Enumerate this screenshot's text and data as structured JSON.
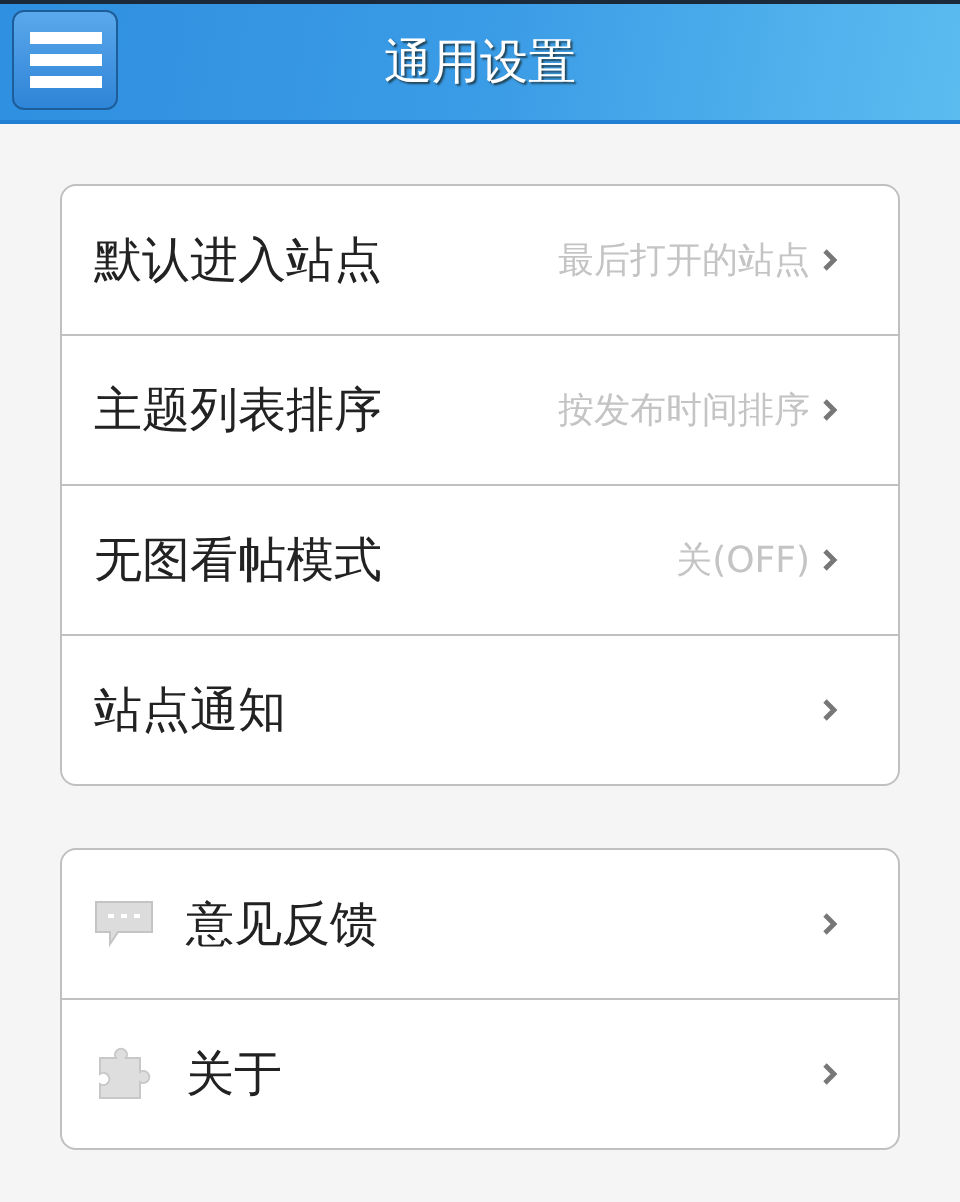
{
  "header": {
    "title": "通用设置"
  },
  "groups": [
    {
      "items": [
        {
          "label": "默认进入站点",
          "value": "最后打开的站点"
        },
        {
          "label": "主题列表排序",
          "value": "按发布时间排序"
        },
        {
          "label": "无图看帖模式",
          "value": "关(OFF)"
        },
        {
          "label": "站点通知"
        }
      ]
    },
    {
      "items": [
        {
          "label": "意见反馈",
          "kind": "chat"
        },
        {
          "label": "关于",
          "kind": "puzzle"
        }
      ]
    }
  ]
}
